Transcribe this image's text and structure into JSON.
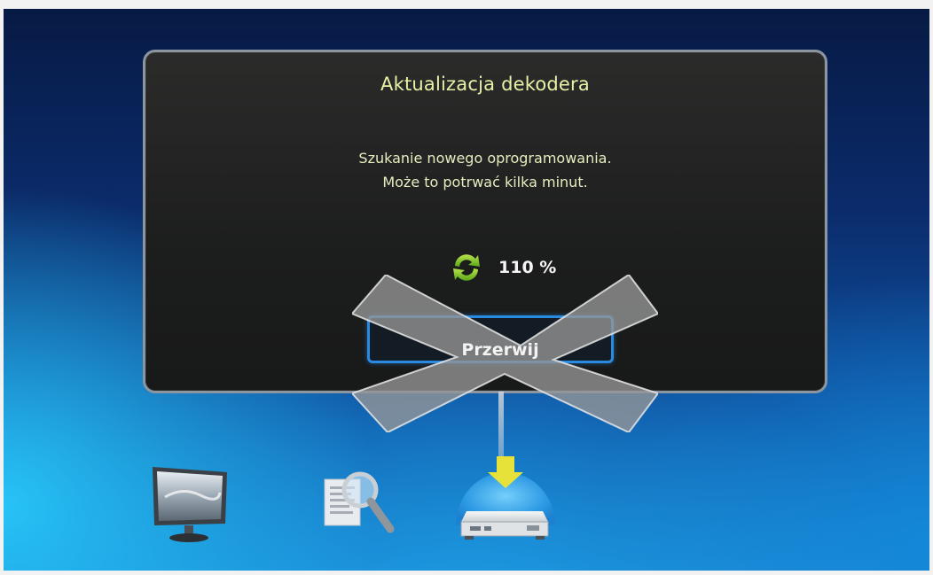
{
  "dialog": {
    "title": "Aktualizacja dekodera",
    "message_line1": "Szukanie nowego oprogramowania.",
    "message_line2": "Może to potrwać kilka minut.",
    "progress_label": "110 %",
    "progress_icon": "sync-icon",
    "cancel_button_label": "Przerwij"
  },
  "dock": {
    "items": [
      {
        "icon": "tv-monitor-icon",
        "selected": false
      },
      {
        "icon": "document-search-icon",
        "selected": false
      },
      {
        "icon": "decoder-update-icon",
        "selected": true
      }
    ]
  },
  "colors": {
    "title_text": "#e9f1a6",
    "message_text": "#e6ecbe",
    "button_border": "#2a8ae0",
    "sync_icon": "#8ccc2a",
    "dialog_border": "#8b96a0"
  }
}
